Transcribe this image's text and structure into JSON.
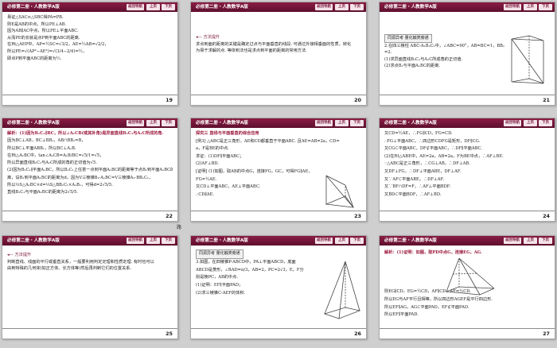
{
  "header_title": "必修第二册・人教数学A版",
  "btn_nav": "返回导航",
  "btn_prev": "上页",
  "btn_next": "下页",
  "stray_text": "路",
  "slides": [
    {
      "page": "19",
      "lines": [
        "易证△SAC≌△SBC得PA=PB.",
        "则E是AB的中点，所以PE⊥AB.",
        "因为AB∥AC中点，所以PE⊥平面ABC.",
        "从而PE的长就是点P到平面ABC的距离.",
        "在Rt△AEP中，AP=½SC=√3/2，AE=½AB=√2/2，",
        "所以PE=√(AP²−AE²)=√(3/4−2/4)=½，",
        "即点P到平面ABC的距离为½."
      ]
    },
    {
      "page": "20",
      "lines": [
        "",
        "方法提升",
        "求点到面的距离的关键是确定过点与平面垂直的线段. 可通过外接相垂面的性质，转化",
        "为易于求解的点. 等体积法也是求点到平面的距离的常用方法."
      ]
    },
    {
      "page": "21",
      "lines": [
        "同源异考 量化触类旁通",
        "2.在四三棱柱 ABC-A₁B₁C₁中，∠ABC=90°，AB=BC=1，BB₁",
        "=2.",
        "(1)求异面直线B₁C₁与A₁C所成角的正切值.",
        "(2)求点B₁与平面A₁BC的距离."
      ]
    },
    {
      "page": "22",
      "lines": [
        "解析：(1)因为B₁C₁∥BC，所以∠A₁CB(或其补角)是异面直线B₁C₁与A₁C所成的角.",
        "因为BC⊥AB，BC⊥BB₁，AB∩BB₁=B，",
        "所以BC⊥平面ABB₁，所以BC⊥A₁B.",
        "在Rt△A₁BC中，tan∠A₁CB=A₁B/BC=√5/1=√5，",
        "所以异面直线B₁C₁与A₁C所成的角的正切值为√5.",
        "(2)因为B₁C₁∥平面A₁BC，所以B₁C₁上任意一点到平面A₁BC的距离等于点B₁到平面A₁BC的距",
        "离，设B₁到平面A₁BC的距离为d，因为V三棱锥B₁-A₁BC=V三棱锥A₁-BB₁C₁，",
        "所以⅓S△A₁BC×d=⅓S△BB₁C₁×A₁B₁，可得d=2√5/5.",
        "直线B₁C₁与平面A₁BC的距离为2√5/5."
      ]
    },
    {
      "page": "23",
      "lines": [
        "探究三 直线与平面垂直的综合应用",
        "[例3] △ABC是正三角形，AE和CD都垂直于平面ABC. 且AE=AB=2a，CD=",
        "a，F是BE的中点.",
        "求证：(1)DF∥平面ABC；",
        "(2)AF⊥BD.",
        "[证明] (1)如图，取AB的中点G，连接FG，GC，可得FG∥AE，",
        "FG=½AE.",
        "又CD⊥平面ABC，AE⊥平面ABC.",
        "∴CD∥AE."
      ]
    },
    {
      "page": "24",
      "lines": [
        "又CD=½AE，∴FG∥CD，FG=CD.",
        "∴FG⊥平面ABC，∴四边形CDFG是矩形，DF∥CG.",
        "又CG⊂平面ABC，DF⊄平面ABC，∴DF∥平面ABC.",
        "(2)在Rt△ABE中，AE=2a，AB=2a，F为BE中点，∴AF⊥BE.",
        "∵△ABC是正三角形，∴CG⊥AB，∴DF⊥AB.",
        "又DF⊥FG，∴DF⊥平面ABE，DF⊥AF.",
        "又∵AF⊂平面ABE，∴DF⊥AF.",
        "又∵BF∩DF=F，∴AF⊥平面BDF.",
        "又BD⊂平面BDF，∴AF⊥BD."
      ]
    },
    {
      "page": "25",
      "lines": [
        "",
        "方法提升",
        "判断直线、线面的平行或垂直关系，一般要利用判定定理和性质定理. 有时也可以",
        "由到特殊的几何体(如正方体、长方体等)然后再判断它们的位置关系."
      ]
    },
    {
      "page": "26",
      "lines": [
        "同源异考 量化触类旁通",
        "3.如图，在四棱锥P-ABCD中，PA⊥平面ABCD，底面",
        "ABCD是菱形，∠BAD=π/3，AB=2，PC=2√3，E，F分",
        "别是棱PC，AB的中点.",
        "(1)证明：EF∥平面PAD；",
        "(2)求三棱锥C-AEF的体积."
      ]
    },
    {
      "page": "27",
      "lines": [
        "解析：(1)证明：如图，取PD中点G，连接EG，AG.",
        "",
        "",
        "",
        "",
        "则EG∥CD，EG=½CD，AF∥CD，AF=½CD.",
        "所以EG与AF平行且相等，所以四边形AGEF是平行四边形.",
        "所以EF∥AG，AG⊂平面PAD，EF⊄平面PAD.",
        "所以EF∥平面PAD."
      ]
    }
  ]
}
